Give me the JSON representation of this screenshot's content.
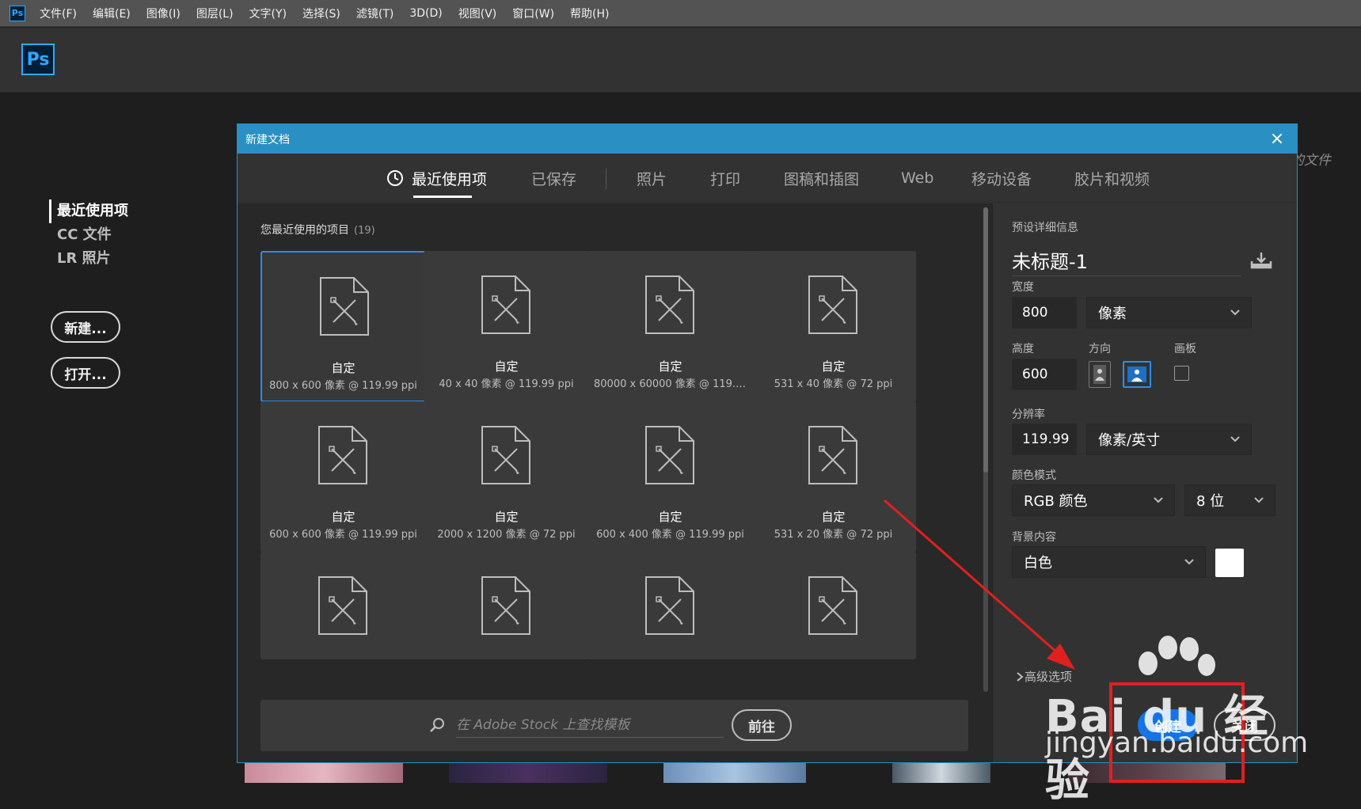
{
  "app": {
    "icon_label": "Ps"
  },
  "menubar": {
    "items": [
      "文件(F)",
      "编辑(E)",
      "图像(I)",
      "图层(L)",
      "文字(Y)",
      "选择(S)",
      "滤镜(T)",
      "3D(D)",
      "视图(V)",
      "窗口(W)",
      "帮助(H)"
    ]
  },
  "header": {
    "logo_label": "Ps"
  },
  "start": {
    "nav": [
      "最近使用项",
      "CC 文件",
      "LR 照片"
    ],
    "new_button": "新建...",
    "open_button": "打开...",
    "background_recent_label": "的文件"
  },
  "dialog": {
    "title": "新建文档",
    "close_glyph": "×",
    "tabs": [
      "最近使用项",
      "已保存",
      "照片",
      "打印",
      "图稿和插图",
      "Web",
      "移动设备",
      "胶片和视频"
    ],
    "active_tab": "最近使用项",
    "recent": {
      "heading": "您最近使用的项目",
      "count": "(19)",
      "items": [
        {
          "name": "自定",
          "desc": "800 x 600 像素 @ 119.99 ppi",
          "selected": true
        },
        {
          "name": "自定",
          "desc": "40 x 40 像素 @ 119.99 ppi"
        },
        {
          "name": "自定",
          "desc": "80000 x 60000 像素 @ 119.9..."
        },
        {
          "name": "自定",
          "desc": "531 x 40 像素 @ 72 ppi"
        },
        {
          "name": "自定",
          "desc": "600 x 600 像素 @ 119.99 ppi"
        },
        {
          "name": "自定",
          "desc": "2000 x 1200 像素 @ 72 ppi"
        },
        {
          "name": "自定",
          "desc": "600 x 400 像素 @ 119.99 ppi"
        },
        {
          "name": "自定",
          "desc": "531 x 20 像素 @ 72 ppi"
        },
        {
          "name": "",
          "desc": ""
        },
        {
          "name": "",
          "desc": ""
        },
        {
          "name": "",
          "desc": ""
        },
        {
          "name": "",
          "desc": ""
        }
      ]
    },
    "stock": {
      "placeholder": "在 Adobe Stock 上查找模板",
      "go_button": "前往"
    },
    "details": {
      "heading": "预设详细信息",
      "doc_name": "未标题-1",
      "width_label": "宽度",
      "width_value": "800",
      "width_unit": "像素",
      "height_label": "高度",
      "height_value": "600",
      "orientation_label": "方向",
      "artboard_label": "画板",
      "resolution_label": "分辨率",
      "resolution_value": "119.99",
      "resolution_unit": "像素/英寸",
      "color_mode_label": "颜色模式",
      "color_mode": "RGB 颜色",
      "bit_depth": "8 位",
      "background_label": "背景内容",
      "background_value": "白色",
      "advanced_label": "高级选项",
      "create_button": "创建",
      "close_button": "关闭"
    }
  },
  "watermark": {
    "line1": "Bai du 经验",
    "line2": "jingyan.baidu.com"
  },
  "colors": {
    "accent": "#1473e6",
    "titlebar": "#2a8fc3",
    "annotation": "#e02020"
  }
}
